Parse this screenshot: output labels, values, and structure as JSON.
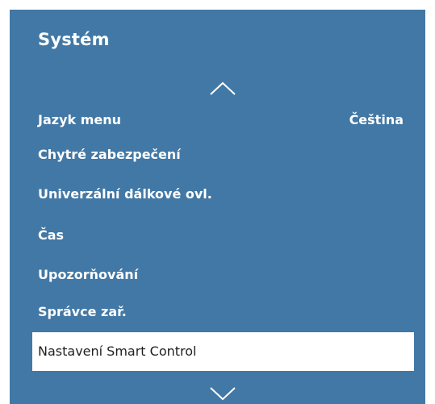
{
  "menu": {
    "title": "Systém",
    "items": [
      {
        "label": "Jazyk menu",
        "value": "Čeština"
      },
      {
        "label": "Chytré zabezpečení"
      },
      {
        "label": "Univerzální dálkové ovl."
      },
      {
        "label": "Čas"
      },
      {
        "label": "Upozorňování"
      },
      {
        "label": "Správce zař."
      },
      {
        "label": "Nastavení Smart Control",
        "selected": true
      }
    ],
    "scroll_up_icon": "chevron-up-icon",
    "scroll_down_icon": "chevron-down-icon"
  },
  "colors": {
    "panel_background": "#4278a5",
    "text": "#ffffff",
    "selected_background": "#ffffff",
    "selected_text": "#1f1f1f"
  }
}
